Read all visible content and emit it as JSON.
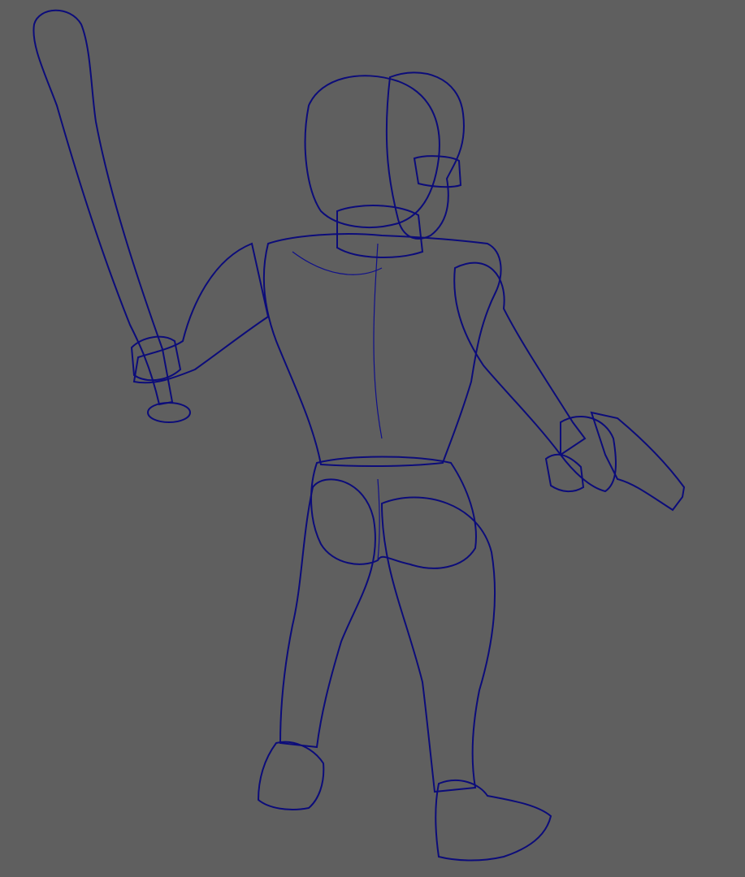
{
  "viewport": {
    "display_mode": "wireframe-on-shaded",
    "background_color": "#5f5f5f",
    "mesh_color": "#9f9fa6",
    "wire_color": "#10108a"
  },
  "scene": {
    "objects": [
      "character-body",
      "head",
      "hair",
      "glasses",
      "torso",
      "left-arm",
      "right-arm",
      "baseball-bat",
      "pistol",
      "pelvis",
      "left-leg",
      "right-leg",
      "left-shoe",
      "right-shoe"
    ]
  }
}
